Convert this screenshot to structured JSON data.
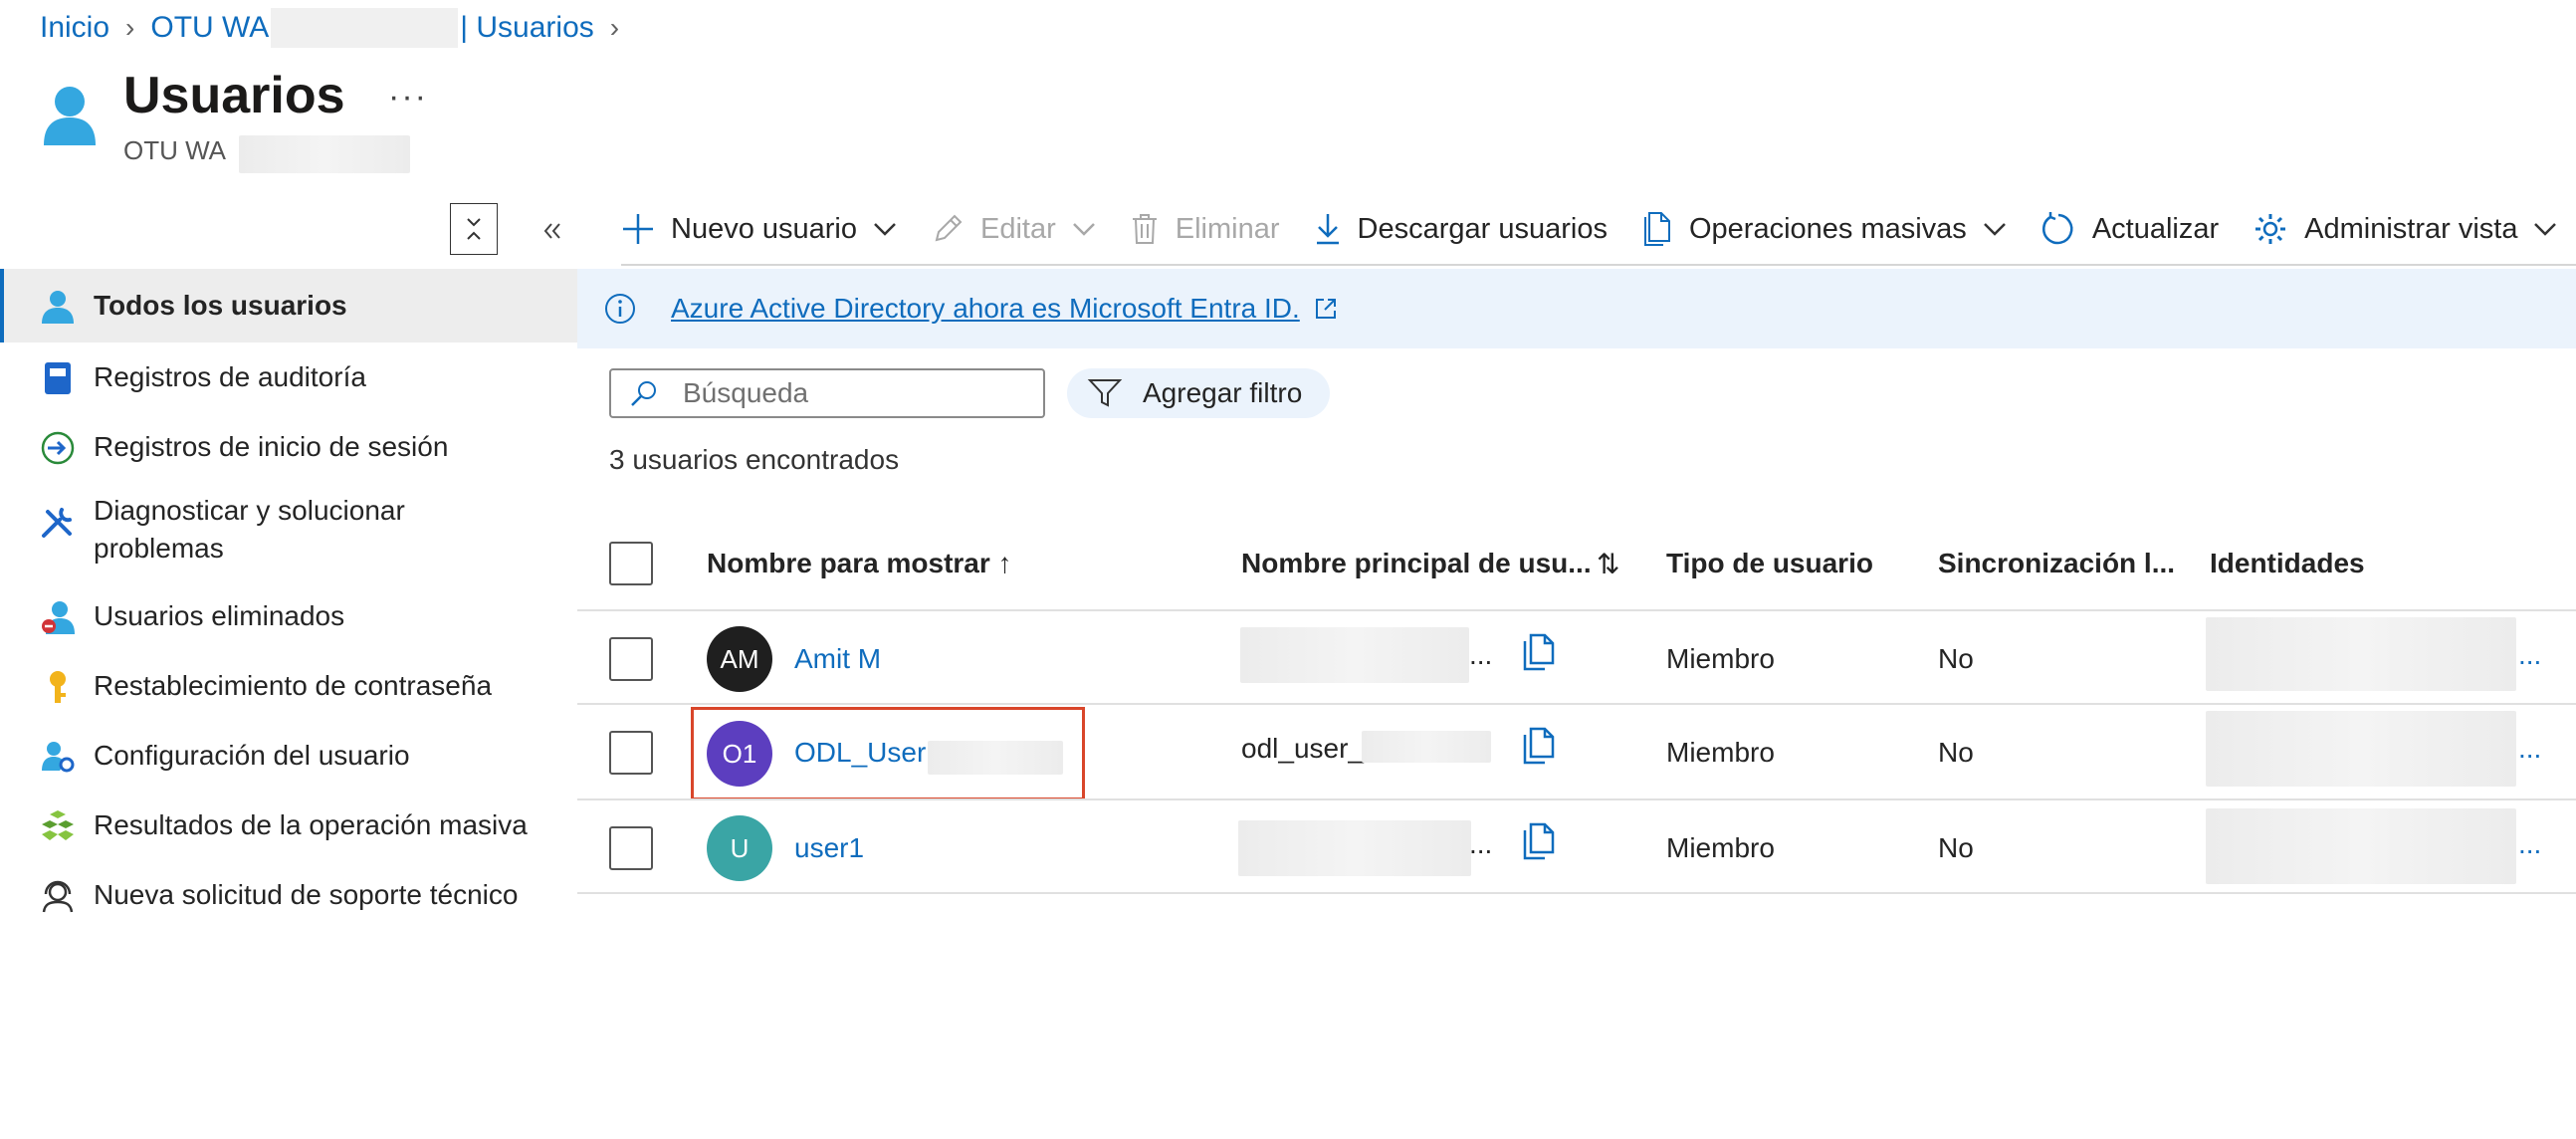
{
  "breadcrumb": {
    "items": [
      "Inicio",
      "OTU WA ",
      "| Usuarios"
    ]
  },
  "header": {
    "title": "Usuarios",
    "more": "···",
    "subtitle": "OTU WA "
  },
  "toolbar": {
    "new_user": "Nuevo usuario",
    "edit": "Editar",
    "delete": "Eliminar",
    "download": "Descargar usuarios",
    "bulk": "Operaciones masivas",
    "refresh": "Actualizar",
    "manage_view": "Administrar vista"
  },
  "sidebar": {
    "items": [
      {
        "label": "Todos los usuarios",
        "icon": "user-icon",
        "active": true
      },
      {
        "label": "Registros de auditoría",
        "icon": "audit-log-icon"
      },
      {
        "label": "Registros de inicio de sesión",
        "icon": "sign-in-icon"
      },
      {
        "label": "Diagnosticar y solucionar problemas",
        "icon": "wrench-icon"
      },
      {
        "label": "Usuarios eliminados",
        "icon": "deleted-user-icon"
      },
      {
        "label": "Restablecimiento de contraseña",
        "icon": "key-icon"
      },
      {
        "label": "Configuración del usuario",
        "icon": "user-settings-icon"
      },
      {
        "label": "Resultados de la operación masiva",
        "icon": "bulk-results-icon"
      },
      {
        "label": "Nueva solicitud de soporte técnico",
        "icon": "support-icon"
      }
    ]
  },
  "banner": {
    "text": "Azure Active Directory ahora es Microsoft Entra ID."
  },
  "search": {
    "placeholder": "Búsqueda"
  },
  "filter": {
    "label": "Agregar filtro"
  },
  "results": {
    "count_text": "3 usuarios encontrados"
  },
  "table": {
    "columns": {
      "display_name": "Nombre para mostrar ↑",
      "upn": "Nombre principal de usu...",
      "user_type": "Tipo de usuario",
      "sync": "Sincronización l...",
      "identities": "Identidades"
    },
    "sort_icon": "⇅",
    "rows": [
      {
        "initials": "AM",
        "name": "Amit M",
        "upn": "...",
        "user_type": "Miembro",
        "sync": "No",
        "identities": "...",
        "avatar_color": "#1f1f1f"
      },
      {
        "initials": "O1",
        "name": "ODL_User",
        "upn": "odl_user_",
        "user_type": "Miembro",
        "sync": "No",
        "identities": "...",
        "avatar_color": "#5c3ebf"
      },
      {
        "initials": "U",
        "name": "user1",
        "upn": "...",
        "user_type": "Miembro",
        "sync": "No",
        "identities": "...",
        "avatar_color": "#3aa5a5"
      }
    ]
  },
  "colors": {
    "accent": "#0f6cbd",
    "highlight": "#d9462a",
    "banner_bg": "#ebf3fc"
  }
}
